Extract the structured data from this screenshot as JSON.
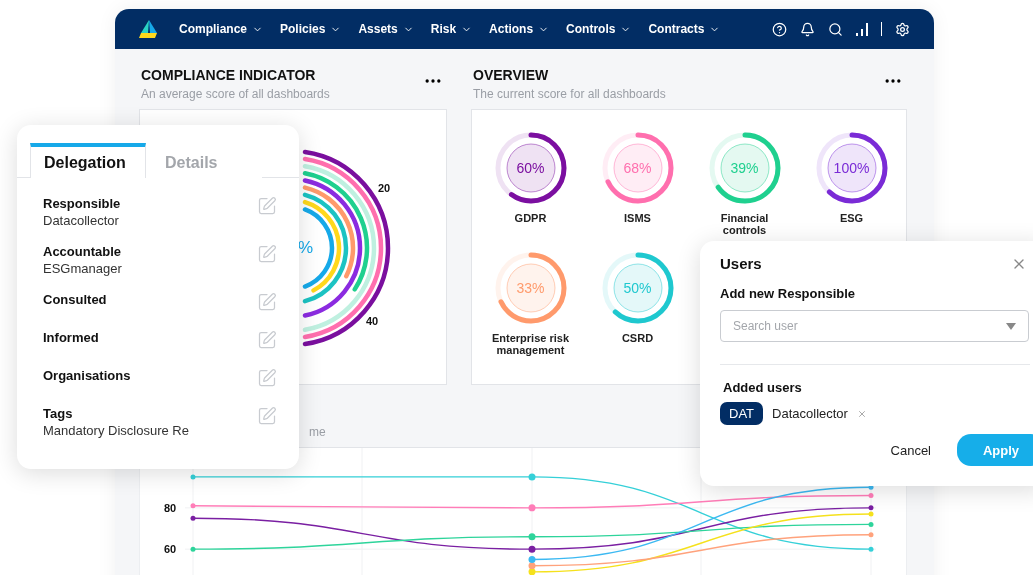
{
  "nav": {
    "menu": [
      {
        "label": "Compliance"
      },
      {
        "label": "Policies"
      },
      {
        "label": "Assets"
      },
      {
        "label": "Risk"
      },
      {
        "label": "Actions"
      },
      {
        "label": "Controls"
      },
      {
        "label": "Contracts"
      }
    ]
  },
  "compliance_indicator": {
    "title": "COMPLIANCE INDICATOR",
    "subtitle": "An average score of all dashboards",
    "center_label": "%",
    "tick_labels": [
      "20",
      "40"
    ]
  },
  "overview": {
    "title": "OVERVIEW",
    "subtitle": "The current score for all dashboards",
    "gauges": [
      {
        "label": "GDPR",
        "value": "60%",
        "level": 0.6,
        "color": "#7b0fa0"
      },
      {
        "label": "ISMS",
        "value": "68%",
        "level": 0.68,
        "color": "#ff6fae"
      },
      {
        "label": "Financial controls",
        "value": "39%",
        "level": 0.65,
        "color": "#1fd08f"
      },
      {
        "label": "ESG",
        "value": "100%",
        "level": 0.62,
        "color": "#7a2bd6"
      },
      {
        "label": "Enterprise risk management",
        "value": "33%",
        "level": 0.68,
        "color": "#ff9a6c"
      },
      {
        "label": "CSRD",
        "value": "50%",
        "level": 0.62,
        "color": "#1fc8cf"
      }
    ]
  },
  "trend": {
    "tab_fragment": "me",
    "chart_data": {
      "type": "line",
      "grid": true,
      "ylim": [
        47,
        109
      ],
      "yticks": [
        60,
        80
      ],
      "series": [
        {
          "color": "#35d0d8",
          "values": [
            95,
            95,
            60
          ]
        },
        {
          "color": "#ff7db8",
          "values": [
            81,
            80,
            86
          ]
        },
        {
          "color": "#7a1fa2",
          "values": [
            75,
            60,
            80
          ]
        },
        {
          "color": "#2ed49b",
          "values": [
            60,
            66,
            72
          ]
        },
        {
          "color": "#f5e11c",
          "values": [
            null,
            49,
            77
          ]
        },
        {
          "color": "#ffa27c",
          "values": [
            null,
            52,
            67
          ]
        },
        {
          "color": "#3cb9f2",
          "values": [
            null,
            55,
            90
          ]
        }
      ]
    }
  },
  "delegation": {
    "tabs": [
      {
        "label": "Delegation",
        "selected": true
      },
      {
        "label": "Details",
        "selected": false
      }
    ],
    "fields": [
      {
        "label": "Responsible",
        "value": "Datacollector"
      },
      {
        "label": "Accountable",
        "value": "ESGmanager"
      },
      {
        "label": "Consulted"
      },
      {
        "label": "Informed"
      },
      {
        "label": "Organisations"
      },
      {
        "label": "Tags",
        "value": "Mandatory Disclosure Re"
      }
    ]
  },
  "users_dialog": {
    "title": "Users",
    "field_label": "Add new Responsible",
    "search": {
      "placeholder": "Search user"
    },
    "added_label": "Added users",
    "added_users": [
      {
        "initials": "DAT",
        "name": "Datacollector"
      }
    ],
    "buttons": [
      "Cancel",
      "Apply"
    ]
  }
}
